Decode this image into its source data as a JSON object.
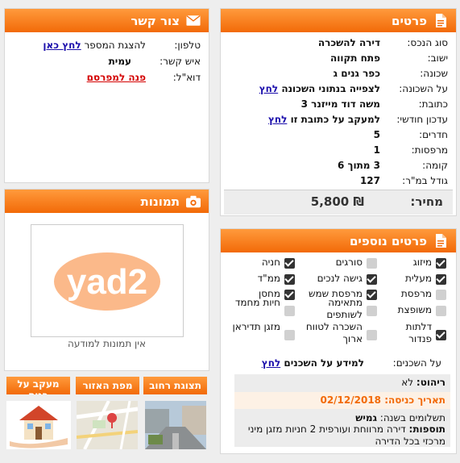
{
  "details": {
    "title": "פרטים",
    "rows": [
      {
        "label": "סוג הנכס:",
        "value": "דירה להשכרה"
      },
      {
        "label": "ישוב:",
        "value": "פתח תקווה"
      },
      {
        "label": "שכונה:",
        "value": "כפר גנים ג"
      },
      {
        "label": "על השכונה:",
        "value": "לצפייה בנתוני השכונה",
        "link": "לחץ"
      },
      {
        "label": "כתובת:",
        "value": "משה דוד מייזנר 3"
      },
      {
        "label": "עדכון חודשי:",
        "value": "למעקב על כתובת זו",
        "link": "לחץ"
      },
      {
        "label": "חדרים:",
        "value": "5"
      },
      {
        "label": "מרפסות:",
        "value": "1"
      },
      {
        "label": "קומה:",
        "value": "3 מתוך 6"
      },
      {
        "label": "גודל במ\"ר:",
        "value": "127"
      }
    ],
    "price_label": "מחיר:",
    "price_value": "5,800 ₪"
  },
  "contact": {
    "title": "צור קשר",
    "phone_label": "טלפון:",
    "phone_text": "להצגת המספר",
    "phone_link": "לחץ כאן",
    "person_label": "איש קשר:",
    "person_value": "עמית",
    "email_label": "דוא\"ל:",
    "email_link": "פנה למפרסם"
  },
  "photos": {
    "title": "תמונות",
    "logo_text": "yad2",
    "no_photos": "אין תמונות למודעה"
  },
  "tabs": [
    "תצוגת רחוב",
    "מפת האזור",
    "מעקב על בנים"
  ],
  "extra": {
    "title": "פרטים נוספים",
    "features": [
      {
        "label": "מיזוג",
        "checked": true
      },
      {
        "label": "סורגים",
        "checked": false
      },
      {
        "label": "חניה",
        "checked": true
      },
      {
        "label": "מעלית",
        "checked": true
      },
      {
        "label": "גישה לנכים",
        "checked": true
      },
      {
        "label": "ממ\"ד",
        "checked": true
      },
      {
        "label": "מרפסת",
        "checked": false
      },
      {
        "label": "מרפסת שמש",
        "checked": true
      },
      {
        "label": "מחסן",
        "checked": true
      },
      {
        "label": "משופצת",
        "checked": false
      },
      {
        "label": "מתאימה לשותפים",
        "checked": false
      },
      {
        "label": "חיות מחמד",
        "checked": false
      },
      {
        "label": "דלתות פנדור",
        "checked": true
      },
      {
        "label": "השכרה לטווח ארוך",
        "checked": false
      },
      {
        "label": "מזגן תדיראן",
        "checked": false
      }
    ],
    "neighbors_label": "על השכנים:",
    "neighbors_text": "למידע על השכנים",
    "neighbors_link": "לחץ",
    "furnish_label": "ריהוט:",
    "furnish_value": "לא",
    "entry_label": "תאריך כניסה:",
    "entry_value": "02/12/2018",
    "payments_label": "תשלומים בשנה:",
    "payments_value": "גמיש",
    "additions_label": "תוספות:",
    "additions_value": "דירה מרווחת ועורפית 2 חניות מזגן מיני מרכזי בכל הדירה"
  },
  "colors": {
    "accent": "#f26a08",
    "link": "#1a0dab",
    "entry": "#f26a08"
  }
}
